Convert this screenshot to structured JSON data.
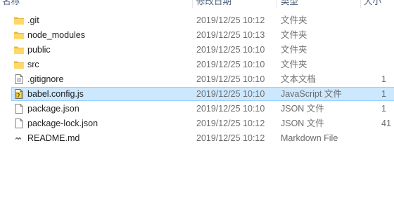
{
  "header": {
    "name_label": "名称",
    "modified_label": "修改日期",
    "type_label": "类型",
    "size_label": "大小"
  },
  "files": [
    {
      "name": ".git",
      "modified": "2019/12/25 10:12",
      "type": "文件夹",
      "size": "",
      "icon": "folder-icon",
      "selected": false
    },
    {
      "name": "node_modules",
      "modified": "2019/12/25 10:13",
      "type": "文件夹",
      "size": "",
      "icon": "folder-icon",
      "selected": false
    },
    {
      "name": "public",
      "modified": "2019/12/25 10:10",
      "type": "文件夹",
      "size": "",
      "icon": "folder-icon",
      "selected": false
    },
    {
      "name": "src",
      "modified": "2019/12/25 10:10",
      "type": "文件夹",
      "size": "",
      "icon": "folder-icon",
      "selected": false
    },
    {
      "name": ".gitignore",
      "modified": "2019/12/25 10:10",
      "type": "文本文档",
      "size": "1",
      "icon": "text-file-icon",
      "selected": false
    },
    {
      "name": "babel.config.js",
      "modified": "2019/12/25 10:10",
      "type": "JavaScript 文件",
      "size": "1",
      "icon": "javascript-file-icon",
      "selected": true
    },
    {
      "name": "package.json",
      "modified": "2019/12/25 10:10",
      "type": "JSON 文件",
      "size": "1",
      "icon": "json-file-icon",
      "selected": false
    },
    {
      "name": "package-lock.json",
      "modified": "2019/12/25 10:12",
      "type": "JSON 文件",
      "size": "41",
      "icon": "json-file-icon",
      "selected": false
    },
    {
      "name": "README.md",
      "modified": "2019/12/25 10:12",
      "type": "Markdown File",
      "size": "",
      "icon": "markdown-file-icon",
      "selected": false
    }
  ],
  "colors": {
    "folder": "#ffd866",
    "folder_dark": "#e8b93b",
    "selection_bg": "#cce8ff",
    "selection_border": "#99d1ff"
  }
}
